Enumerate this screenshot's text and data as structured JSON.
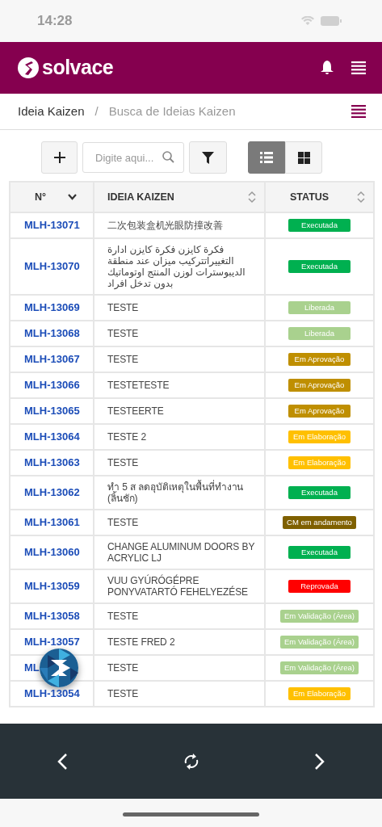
{
  "status_bar": {
    "time": "14:28"
  },
  "header": {
    "logo": "solvace"
  },
  "breadcrumb": {
    "items": [
      {
        "label": "Ideia Kaizen",
        "selected": false
      },
      {
        "label": "Busca de Ideias Kaizen",
        "selected": true
      }
    ],
    "separator": "/"
  },
  "toolbar": {
    "search": {
      "placeholder": "Digite aqui..."
    },
    "views": [
      {
        "kind": "list",
        "selected": true
      },
      {
        "kind": "grid",
        "selected": false
      }
    ]
  },
  "table": {
    "columns": [
      {
        "label": "N°",
        "kind": "dropdown"
      },
      {
        "label": "IDEIA KAIZEN",
        "kind": "sortable"
      },
      {
        "label": "STATUS",
        "kind": "sortable"
      }
    ],
    "rows": [
      {
        "id": "MLH-13071",
        "idea": "二次包装盒机光眼防撞改善",
        "status": "Executada",
        "color": "#00b050"
      },
      {
        "id": "MLH-13070",
        "idea": "فكرة كايزن فكرة كايزن ادارة التغييراتتركيب ميزان عند منطقة الديبوسترات لوزن المنتج اوتوماتيك بدون تدخل افراد",
        "status": "Executada",
        "color": "#00b050"
      },
      {
        "id": "MLH-13069",
        "idea": "TESTE",
        "status": "Liberada",
        "color": "#a9d18e"
      },
      {
        "id": "MLH-13068",
        "idea": "TESTE",
        "status": "Liberada",
        "color": "#a9d18e"
      },
      {
        "id": "MLH-13067",
        "idea": "TESTE",
        "status": "Em Aprovação",
        "color": "#bf8f00"
      },
      {
        "id": "MLH-13066",
        "idea": "TESTETESTE",
        "status": "Em Aprovação",
        "color": "#bf8f00"
      },
      {
        "id": "MLH-13065",
        "idea": "TESTEERTE",
        "status": "Em Aprovação",
        "color": "#bf8f00"
      },
      {
        "id": "MLH-13064",
        "idea": "TESTE 2",
        "status": "Em Elaboração",
        "color": "#ffc000"
      },
      {
        "id": "MLH-13063",
        "idea": "TESTE",
        "status": "Em Elaboração",
        "color": "#ffc000"
      },
      {
        "id": "MLH-13062",
        "idea": "ทำ 5 ส ลดอุบัติเหตุในพื้นที่ทำงาน (ลิ้นชัก)",
        "status": "Executada",
        "color": "#00b050"
      },
      {
        "id": "MLH-13061",
        "idea": "TESTE",
        "status": "CM em andamento",
        "color": "#7f6000"
      },
      {
        "id": "MLH-13060",
        "idea": "CHANGE ALUMINUM DOORS BY ACRYLIC LJ",
        "status": "Executada",
        "color": "#00b050"
      },
      {
        "id": "MLH-13059",
        "idea": "VUU GYÚRÓGÉPRE PONYVATARTÓ FEHELYEZÉSE",
        "status": "Reprovada",
        "color": "#ff0000"
      },
      {
        "id": "MLH-13058",
        "idea": "TESTE",
        "status": "Em Validação (Área)",
        "color": "#a9d18e"
      },
      {
        "id": "MLH-13057",
        "idea": "TESTE FRED 2",
        "status": "Em Validação (Área)",
        "color": "#a9d18e"
      },
      {
        "id": "ML",
        "idea": "TESTE",
        "status": "Em Validação (Área)",
        "color": "#a9d18e",
        "overlay": true
      },
      {
        "id": "MLH-13054",
        "idea": "TESTE",
        "status": "Em Elaboração",
        "color": "#ffc000"
      }
    ]
  }
}
